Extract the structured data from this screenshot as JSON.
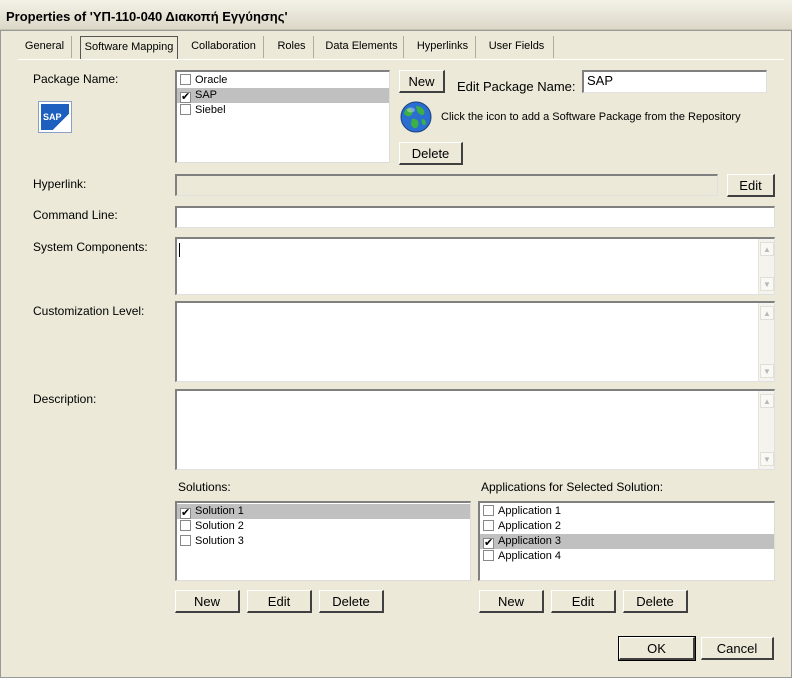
{
  "window": {
    "title": "Properties of 'ΥΠ-110-040 Διακοπή Εγγύησης'"
  },
  "tabs": [
    "General",
    "Software Mapping",
    "Collaboration",
    "Roles",
    "Data Elements",
    "Hyperlinks",
    "User Fields"
  ],
  "package": {
    "label": "Package Name:",
    "logo_icon": "sap-logo-icon",
    "logo_text": "SAP",
    "items": [
      {
        "label": "Oracle",
        "checked": false
      },
      {
        "label": "SAP",
        "checked": true
      },
      {
        "label": "Siebel",
        "checked": false
      }
    ],
    "new_label": "New",
    "delete_label": "Delete",
    "edit_name_label": "Edit Package Name:",
    "edit_name_value": "SAP",
    "repository_icon": "globe-icon",
    "repository_hint": "Click the icon to add a Software Package from the Repository"
  },
  "hyperlink": {
    "label": "Hyperlink:",
    "value": "",
    "edit_label": "Edit"
  },
  "command_line": {
    "label": "Command Line:",
    "value": ""
  },
  "system_components": {
    "label": "System Components:",
    "value": ""
  },
  "customization_level": {
    "label": "Customization Level:",
    "value": ""
  },
  "description": {
    "label": "Description:",
    "value": ""
  },
  "solutions": {
    "label": "Solutions:",
    "items": [
      {
        "label": "Solution 1",
        "checked": true
      },
      {
        "label": "Solution 2",
        "checked": false
      },
      {
        "label": "Solution 3",
        "checked": false
      }
    ],
    "new_label": "New",
    "edit_label": "Edit",
    "delete_label": "Delete"
  },
  "applications": {
    "label": "Applications for Selected Solution:",
    "items": [
      {
        "label": "Application 1",
        "checked": false
      },
      {
        "label": "Application 2",
        "checked": false
      },
      {
        "label": "Application 3",
        "checked": true
      },
      {
        "label": "Application 4",
        "checked": false
      }
    ],
    "new_label": "New",
    "edit_label": "Edit",
    "delete_label": "Delete"
  },
  "footer": {
    "ok_label": "OK",
    "cancel_label": "Cancel"
  },
  "colors": {
    "dialog_bg": "#ece9d8",
    "selection_bg": "#c0c0c0"
  }
}
